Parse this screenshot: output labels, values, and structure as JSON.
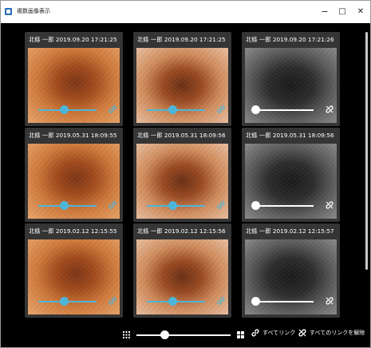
{
  "window": {
    "title": "複数画像表示",
    "controls": {
      "minimize": "−",
      "maximize": "□",
      "close": "✕"
    }
  },
  "colors": {
    "accent": "#4db6d8",
    "slider_white": "#ffffff",
    "tile_bg": "#353535"
  },
  "tiles": [
    {
      "label": "北條 一郎 2019.09.20 17:21:25",
      "image": "dermoscopy-warm",
      "slider": "accent",
      "link_icon": "link-icon",
      "slider_level": 0.45
    },
    {
      "label": "北條 一郎 2019.09.20 17:21:25",
      "image": "dermoscopy-polarized",
      "slider": "accent",
      "link_icon": "link-icon",
      "slider_level": 0.45
    },
    {
      "label": "北條 一郎 2019.09.20 17:21:26",
      "image": "dermoscopy-gray",
      "slider": "white",
      "link_icon": "unlink-icon",
      "slider_level": 0.0
    },
    {
      "label": "北條 一郎 2019.05.31 18:09:55",
      "image": "dermoscopy-warm",
      "slider": "accent",
      "link_icon": "link-icon",
      "slider_level": 0.45
    },
    {
      "label": "北條 一郎 2019.05.31 18:09:56",
      "image": "dermoscopy-polarized",
      "slider": "accent",
      "link_icon": "link-icon",
      "slider_level": 0.45
    },
    {
      "label": "北條 一郎 2019.05.31 18:09:56",
      "image": "dermoscopy-gray",
      "slider": "white",
      "link_icon": "unlink-icon",
      "slider_level": 0.0
    },
    {
      "label": "北條 一郎 2019.02.12 12:15:55",
      "image": "dermoscopy-warm",
      "slider": "accent",
      "link_icon": "link-icon",
      "slider_level": 0.45
    },
    {
      "label": "北條 一郎 2019.02.12 12:15:56",
      "image": "dermoscopy-polarized",
      "slider": "accent",
      "link_icon": "link-icon",
      "slider_level": 0.45
    },
    {
      "label": "北條 一郎 2019.02.12 12:15:57",
      "image": "dermoscopy-gray",
      "slider": "white",
      "link_icon": "unlink-icon",
      "slider_level": 0.0
    }
  ],
  "toolbar": {
    "grid_small_icon": "grid-small-icon",
    "grid_large_icon": "grid-large-icon",
    "zoom_level": 0.3,
    "link_all_label": "すべてリンク",
    "unlink_all_label": "すべてのリンクを解除"
  }
}
